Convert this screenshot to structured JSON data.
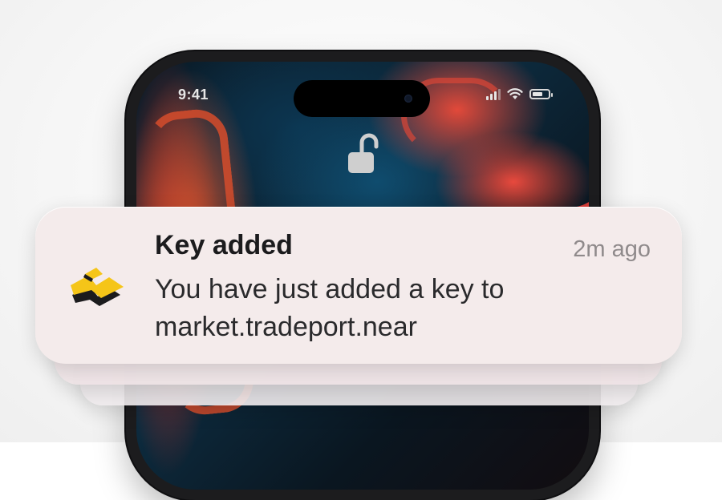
{
  "status_bar": {
    "time": "9:41",
    "icons": [
      "cellular-signal-icon",
      "wifi-icon",
      "battery-icon"
    ]
  },
  "lock_screen": {
    "lock_icon": "unlocked-padlock-icon"
  },
  "notification": {
    "app_icon": "near-wallet-logo-icon",
    "title": "Key added",
    "time": "2m ago",
    "body_line_1": "You have just added a key to",
    "body_line_2": "market.tradeport.near"
  },
  "colors": {
    "notification_bg": "#f4ebeb",
    "logo_yellow": "#f5c518",
    "logo_dark": "#1b1b1d"
  }
}
